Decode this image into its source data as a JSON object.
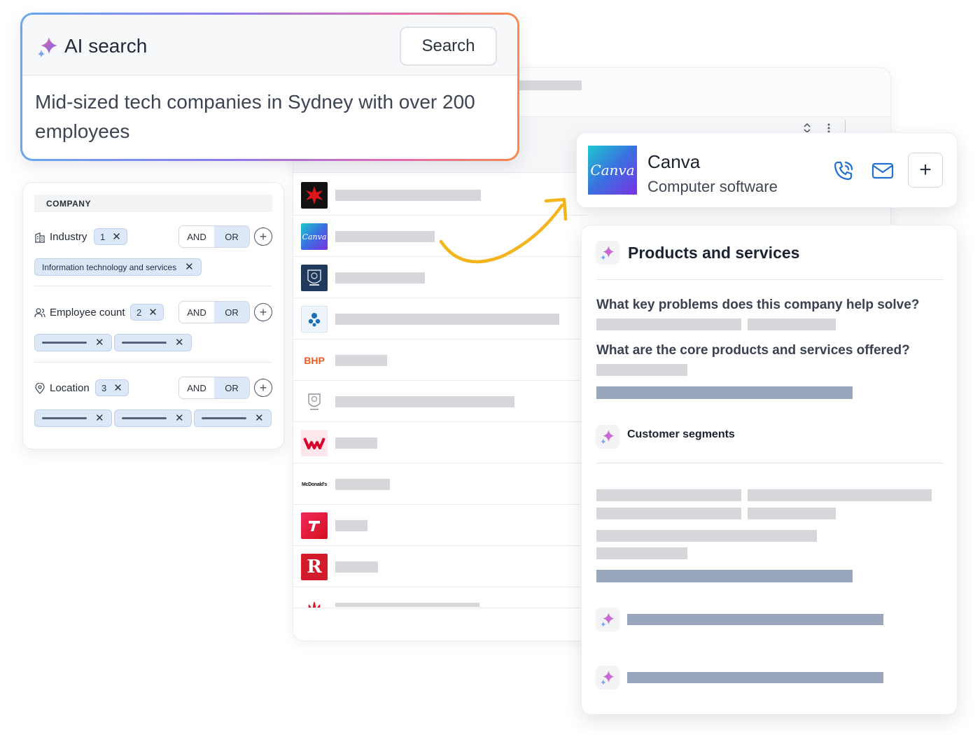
{
  "ai_search": {
    "title": "AI search",
    "button": "Search",
    "query": "Mid-sized tech companies in Sydney with over 200 employees"
  },
  "filters": {
    "section": "COMPANY",
    "and_label": "AND",
    "or_label": "OR",
    "industry": {
      "label": "Industry",
      "count": "1",
      "chip": "Information technology and services"
    },
    "employee_count": {
      "label": "Employee count",
      "count": "2"
    },
    "location": {
      "label": "Location",
      "count": "3"
    }
  },
  "company_list": {
    "bhp_logo_text": "BHP",
    "mcdonalds_logo_text": "McDonald's",
    "canva_logo_text": "Canva",
    "r_logo_text": "R"
  },
  "company": {
    "name": "Canva",
    "category": "Computer software",
    "logo_text": "Canva"
  },
  "details": {
    "title": "Products and services",
    "question_1": "What key problems does this company help solve?",
    "question_2": "What are the core products and services offered?",
    "segments_title": "Customer segments"
  },
  "colors": {
    "gradient_start": "#6aa6ef",
    "gradient_end": "#f58a4a",
    "chip_bg": "#dce8f8",
    "arrow": "#f3b51b",
    "icon_blue": "#1f6fd6"
  }
}
